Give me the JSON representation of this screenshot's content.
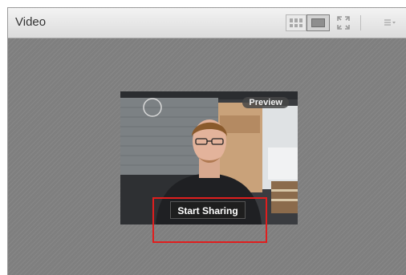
{
  "window": {
    "title": "Video",
    "toolbar": {
      "grid_view_icon": "grid-layout-icon",
      "single_view_icon": "single-layout-icon",
      "fullscreen_icon": "fullscreen-icon",
      "menu_icon": "pod-menu-icon"
    }
  },
  "video": {
    "preview_label": "Preview",
    "start_sharing_label": "Start Sharing"
  },
  "colors": {
    "title_bar": "#e6e6e6",
    "stage_background": "#7f7f7f",
    "button_background": "#1e1e1e",
    "highlight_border": "#e01e1e"
  }
}
